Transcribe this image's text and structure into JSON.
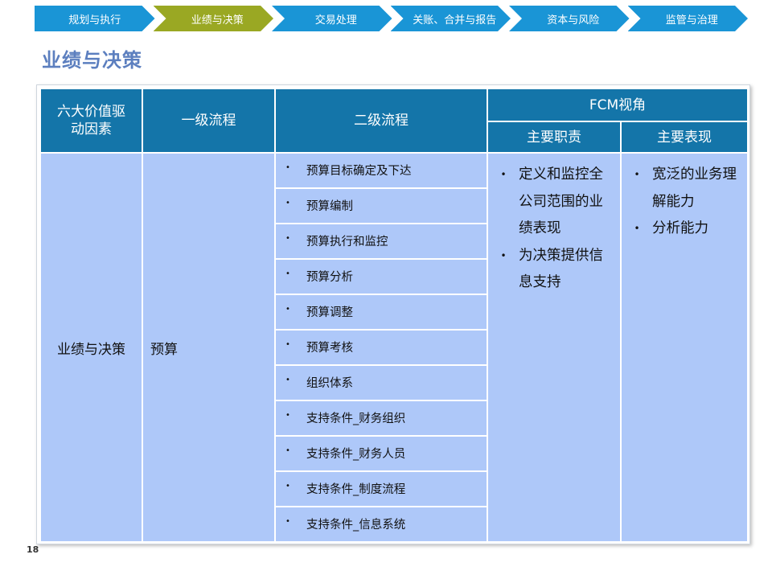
{
  "nav": {
    "items": [
      {
        "label": "规划与执行",
        "active": false
      },
      {
        "label": "业绩与决策",
        "active": true
      },
      {
        "label": "交易处理",
        "active": false
      },
      {
        "label": "关账、合并与报告",
        "active": false
      },
      {
        "label": "资本与风险",
        "active": false
      },
      {
        "label": "监管与治理",
        "active": false
      }
    ]
  },
  "page": {
    "title": "业绩与决策",
    "number": "18"
  },
  "table": {
    "headers": {
      "driver": "六大价值驱动因素",
      "level1": "一级流程",
      "level2": "二级流程",
      "fcm": "FCM视角",
      "duties": "主要职责",
      "performance": "主要表现"
    },
    "row": {
      "driver": "业绩与决策",
      "level1": "预算",
      "level2_items": [
        "预算目标确定及下达",
        "预算编制",
        "预算执行和监控",
        "预算分析",
        "预算调整",
        "预算考核",
        "组织体系",
        "支持条件_财务组织",
        "支持条件_财务人员",
        "支持条件_制度流程",
        "支持条件_信息系统"
      ],
      "duties": [
        "定义和监控全公司范围的业绩表现",
        "为决策提供信息支持"
      ],
      "performance": [
        "宽泛的业务理解能力",
        "分析能力"
      ]
    },
    "bullet_symbol": "•"
  },
  "colors": {
    "nav_blue": "#1a95d6",
    "nav_active": "#9aa823",
    "header_blue": "#1475a9",
    "cell_blue": "#aec8f9",
    "title_blue": "#5c7fbf"
  }
}
